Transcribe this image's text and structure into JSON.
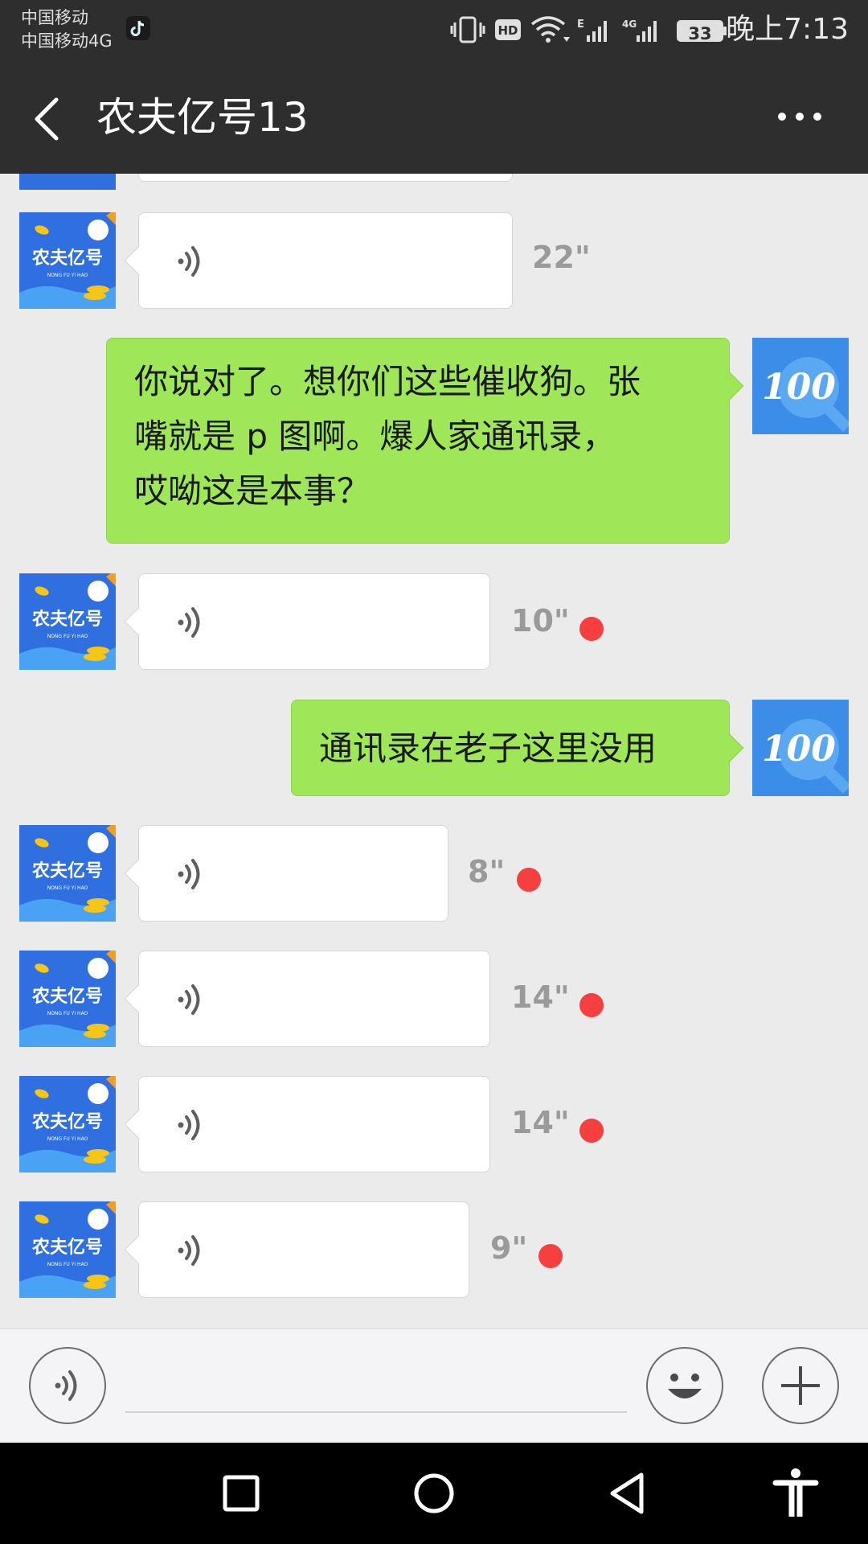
{
  "status_bar": {
    "carrier_1": "中国移动",
    "carrier_2": "中国移动4G",
    "battery": "33",
    "time": "晚上7:13",
    "icons": [
      "tiktok-icon",
      "vibrate-icon",
      "hd-icon",
      "wifi-icon",
      "signal-e-icon",
      "signal-4g-icon",
      "battery-icon"
    ]
  },
  "header": {
    "title": "农夫亿号13",
    "back_icon": "chevron-left-icon",
    "more_icon": "more-dots-icon"
  },
  "contact_avatar": {
    "text": "农夫亿号",
    "subtext": "NONG FU YI HAO"
  },
  "self_avatar": {
    "text": "100"
  },
  "messages": [
    {
      "type": "voice",
      "from": "contact",
      "duration": "22\"",
      "unread": false
    },
    {
      "type": "text",
      "from": "self",
      "text": "你说对了。想你们这些催收狗。张\n嘴就是 p 图啊。爆人家通讯录，\n哎呦这是本事？"
    },
    {
      "type": "voice",
      "from": "contact",
      "duration": "10\"",
      "unread": true
    },
    {
      "type": "text",
      "from": "self",
      "text": "通讯录在老子这里没用"
    },
    {
      "type": "voice",
      "from": "contact",
      "duration": "8\"",
      "unread": true
    },
    {
      "type": "voice",
      "from": "contact",
      "duration": "14\"",
      "unread": true
    },
    {
      "type": "voice",
      "from": "contact",
      "duration": "14\"",
      "unread": true
    },
    {
      "type": "voice",
      "from": "contact",
      "duration": "9\"",
      "unread": true
    }
  ],
  "input_bar": {
    "placeholder": "",
    "icons": [
      "voice-mode-icon",
      "emoji-icon",
      "plus-icon"
    ]
  },
  "nav_bar": {
    "icons": [
      "recent-apps-icon",
      "home-icon",
      "back-triangle-icon",
      "accessibility-icon"
    ]
  },
  "colors": {
    "header_bg": "#2e2e2e",
    "chat_bg": "#ebebeb",
    "outgoing_bubble": "#9fe658",
    "incoming_bubble": "#ffffff",
    "unread_dot": "#f64040",
    "contact_avatar_bg": "#2f6fe0",
    "self_avatar_bg": "#3b8de8"
  }
}
